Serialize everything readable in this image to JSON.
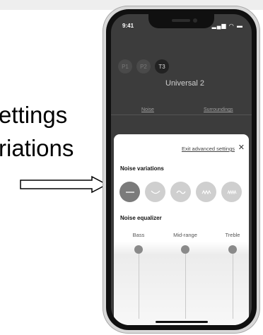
{
  "callout": {
    "line1": "ettings",
    "line2": "riations"
  },
  "status_bar": {
    "time": "9:41",
    "icons_text": "▂▄▆ ◠ ▬"
  },
  "app": {
    "presets": [
      {
        "label": "P1",
        "active": false
      },
      {
        "label": "P2",
        "active": false
      },
      {
        "label": "T3",
        "active": true
      }
    ],
    "profile_name": "Universal 2",
    "tabs": [
      {
        "label": "Noise"
      },
      {
        "label": "Surroundings"
      }
    ]
  },
  "sheet": {
    "exit_label": "Exit advanced settings",
    "close_glyph": "✕",
    "noise_variations_title": "Noise variations",
    "variations": [
      {
        "icon": "flat-line-icon",
        "glyph": "—",
        "selected": true
      },
      {
        "icon": "low-wave-icon",
        "glyph": "﹀",
        "selected": false
      },
      {
        "icon": "wave-icon",
        "glyph": "〰",
        "selected": false
      },
      {
        "icon": "zigzag-icon",
        "glyph": "ʌʌʌ",
        "selected": false
      },
      {
        "icon": "dense-zigzag-icon",
        "glyph": "ᴧᴧᴧᴧ",
        "selected": false
      }
    ],
    "noise_equalizer_title": "Noise equalizer",
    "equalizer": [
      {
        "label": "Bass"
      },
      {
        "label": "Mid-range"
      },
      {
        "label": "Treble"
      }
    ]
  },
  "colors": {
    "sheet_background": "#ffffff",
    "selected_variation": "#7b7b7b",
    "unselected_variation": "#cfcfcf",
    "app_background": "#3c3c3c"
  }
}
